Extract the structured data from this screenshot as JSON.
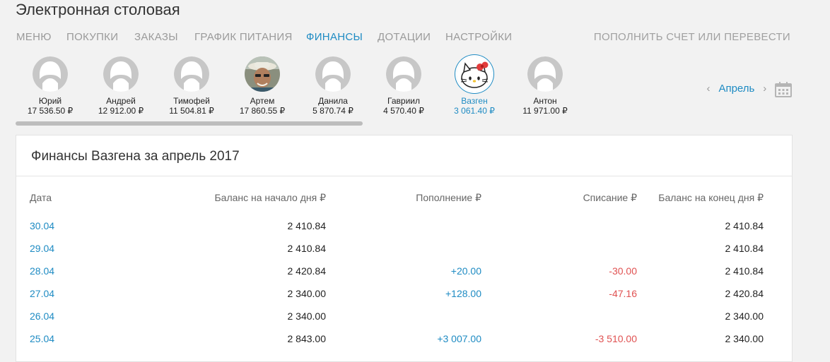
{
  "app": {
    "title": "Электронная столовая"
  },
  "nav": {
    "items": [
      {
        "label": "МЕНЮ"
      },
      {
        "label": "ПОКУПКИ"
      },
      {
        "label": "ЗАКАЗЫ"
      },
      {
        "label": "ГРАФИК ПИТАНИЯ"
      },
      {
        "label": "ФИНАНСЫ",
        "active": true
      },
      {
        "label": "ДОТАЦИИ"
      },
      {
        "label": "НАСТРОЙКИ"
      }
    ],
    "right_action": "ПОПОЛНИТЬ СЧЕТ ИЛИ ПЕРЕВЕСТИ"
  },
  "people": [
    {
      "name": "Юрий",
      "balance": "17 536.50 ₽",
      "avatar": "default-avatar-icon"
    },
    {
      "name": "Андрей",
      "balance": "12 912.00 ₽",
      "avatar": "default-avatar-icon"
    },
    {
      "name": "Тимофей",
      "balance": "11 504.81 ₽",
      "avatar": "default-avatar-icon"
    },
    {
      "name": "Артем",
      "balance": "17 860.55 ₽",
      "avatar": "photo-avatar"
    },
    {
      "name": "Данила",
      "balance": "5 870.74 ₽",
      "avatar": "default-avatar-icon"
    },
    {
      "name": "Гавриил",
      "balance": "4 570.40 ₽",
      "avatar": "default-avatar-icon"
    },
    {
      "name": "Вазген",
      "balance": "3 061.40 ₽",
      "avatar": "hello-kitty-avatar",
      "active": true
    },
    {
      "name": "Антон",
      "balance": "11 971.00 ₽",
      "avatar": "default-avatar-icon"
    }
  ],
  "month_nav": {
    "prev": "‹",
    "label": "Апрель",
    "next": "›",
    "calendar_icon": "calendar-icon"
  },
  "finance": {
    "title": "Финансы Вазгена за апрель 2017",
    "columns": {
      "date": "Дата",
      "start": "Баланс на начало дня ₽",
      "topup": "Пополнение ₽",
      "charge": "Списание ₽",
      "end": "Баланс на конец дня ₽"
    },
    "rows": [
      {
        "date": "30.04",
        "start": "2 410.84",
        "topup": "",
        "charge": "",
        "end": "2 410.84"
      },
      {
        "date": "29.04",
        "start": "2 410.84",
        "topup": "",
        "charge": "",
        "end": "2 410.84"
      },
      {
        "date": "28.04",
        "start": "2 420.84",
        "topup": "+20.00",
        "charge": "-30.00",
        "end": "2 410.84"
      },
      {
        "date": "27.04",
        "start": "2 340.00",
        "topup": "+128.00",
        "charge": "-47.16",
        "end": "2 420.84"
      },
      {
        "date": "26.04",
        "start": "2 340.00",
        "topup": "",
        "charge": "",
        "end": "2 340.00"
      },
      {
        "date": "25.04",
        "start": "2 843.00",
        "topup": "+3 007.00",
        "charge": "-3 510.00",
        "end": "2 340.00"
      }
    ]
  },
  "colors": {
    "accent": "#1e8bc3",
    "negative": "#e05252",
    "muted": "#9a9a9a"
  }
}
